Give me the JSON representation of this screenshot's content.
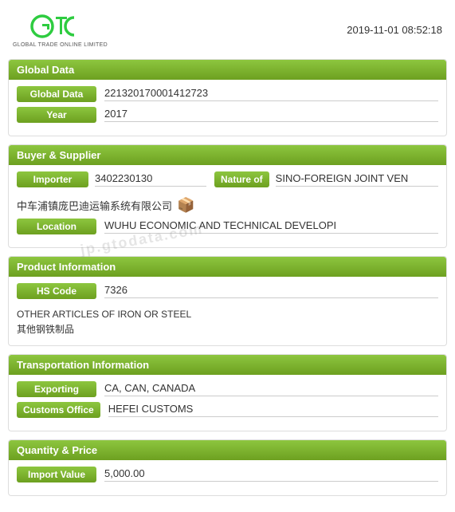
{
  "header": {
    "timestamp": "2019-11-01 08:52:18",
    "logo_tagline": "GLOBAL TRADE ONLINE LIMITED"
  },
  "global_data_section": {
    "title": "Global Data",
    "fields": {
      "global_data_label": "Global Data",
      "global_data_value": "221320170001412723",
      "year_label": "Year",
      "year_value": "2017"
    }
  },
  "buyer_supplier_section": {
    "title": "Buyer & Supplier",
    "importer_label": "Importer",
    "importer_value": "3402230130",
    "nature_label": "Nature of",
    "nature_value": "SINO-FOREIGN JOINT VEN",
    "company_name": "中车浦镇庞巴迪运输系统有限公司",
    "location_label": "Location",
    "location_value": "WUHU ECONOMIC AND TECHNICAL DEVELOPI"
  },
  "product_section": {
    "title": "Product Information",
    "hs_code_label": "HS Code",
    "hs_code_value": "7326",
    "description_en": "OTHER ARTICLES OF IRON OR STEEL",
    "description_cn": "其他钢铁制品"
  },
  "transport_section": {
    "title": "Transportation Information",
    "exporting_label": "Exporting",
    "exporting_value": "CA, CAN, CANADA",
    "customs_label": "Customs Office",
    "customs_value": "HEFEI CUSTOMS"
  },
  "quantity_price_section": {
    "title": "Quantity & Price",
    "import_value_label": "Import Value",
    "import_value_value": "5,000.00"
  },
  "watermark": "jp.gtodata.com"
}
